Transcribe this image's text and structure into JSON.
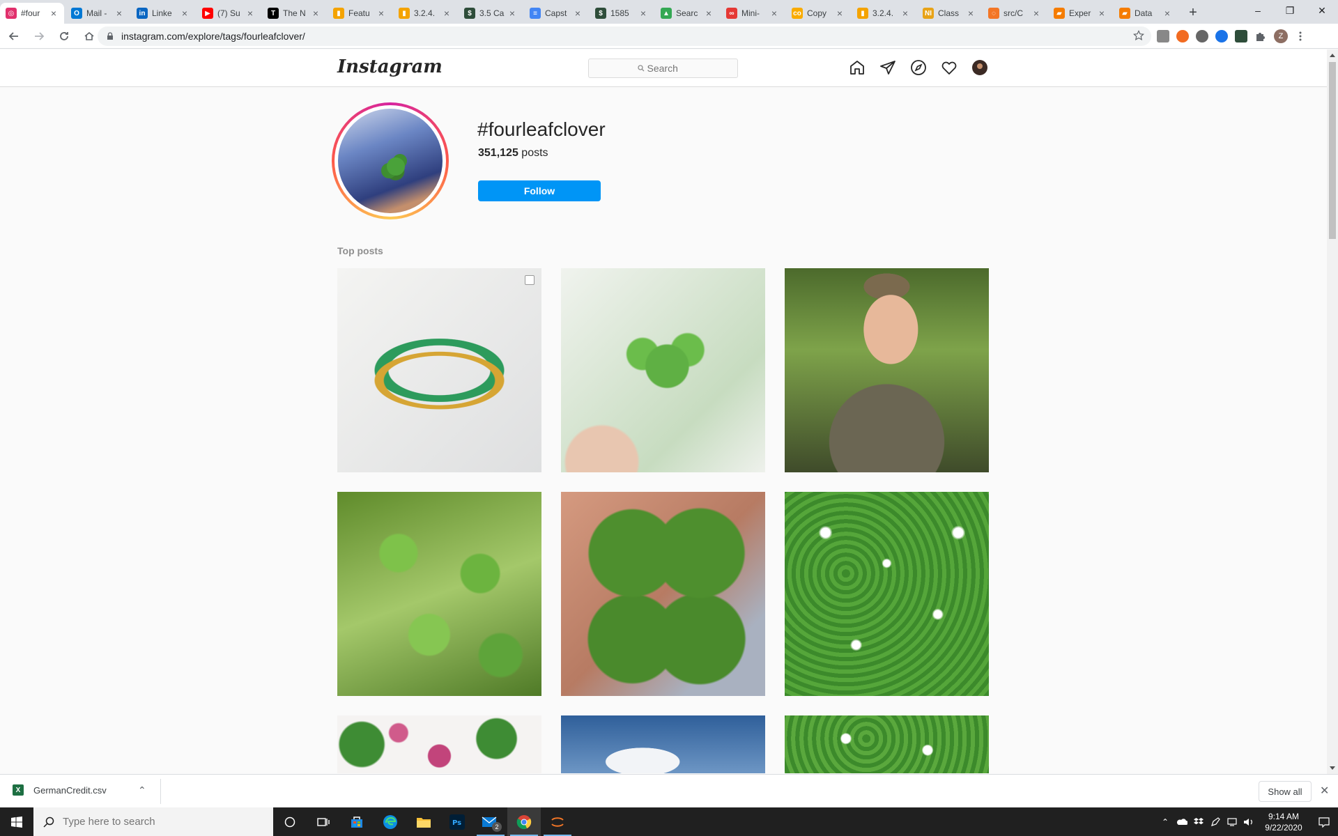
{
  "browser": {
    "tabs": [
      {
        "title": "#four",
        "favicon": "instagram-icon",
        "color": "#e1306c",
        "active": true
      },
      {
        "title": "Mail -",
        "favicon": "outlook-icon",
        "color": "#0078d4"
      },
      {
        "title": "Linke",
        "favicon": "linkedin-icon",
        "color": "#0a66c2"
      },
      {
        "title": "(7) Su",
        "favicon": "youtube-icon",
        "color": "#ff0000"
      },
      {
        "title": "The N",
        "favicon": "nytimes-icon",
        "color": "#000000"
      },
      {
        "title": "Featu",
        "favicon": "chart-icon",
        "color": "#f4a300"
      },
      {
        "title": "3.2.4.",
        "favicon": "chart-icon",
        "color": "#f4a300"
      },
      {
        "title": "3.5 Ca",
        "favicon": "dollar-icon",
        "color": "#2e4d3a"
      },
      {
        "title": "Capst",
        "favicon": "docs-icon",
        "color": "#4285f4"
      },
      {
        "title": "1585",
        "favicon": "dollar-icon",
        "color": "#2e4d3a"
      },
      {
        "title": "Searc",
        "favicon": "drive-icon",
        "color": "#34a853"
      },
      {
        "title": "Mini-",
        "favicon": "link-icon",
        "color": "#e53935"
      },
      {
        "title": "Copy",
        "favicon": "colab-icon",
        "color": "#f9ab00"
      },
      {
        "title": "3.2.4.",
        "favicon": "chart-icon",
        "color": "#f4a300"
      },
      {
        "title": "Class",
        "favicon": "ni-icon",
        "color": "#e8a317"
      },
      {
        "title": "src/C",
        "favicon": "jupyter-icon",
        "color": "#f37626"
      },
      {
        "title": "Exper",
        "favicon": "book-icon",
        "color": "#f57c00"
      },
      {
        "title": "Data",
        "favicon": "book-icon",
        "color": "#f57c00"
      }
    ],
    "url": "instagram.com/explore/tags/fourleafclover/",
    "profile_initial": "Z"
  },
  "instagram": {
    "logo": "Instagram",
    "search_placeholder": "Search",
    "hashtag": "#fourleafclover",
    "post_count": "351,125",
    "post_count_suffix": "posts",
    "follow_label": "Follow",
    "top_posts_label": "Top posts"
  },
  "downloads": {
    "file_name": "GermanCredit.csv",
    "show_all_label": "Show all"
  },
  "taskbar": {
    "search_placeholder": "Type here to search",
    "mail_badge": "2",
    "time": "9:14 AM",
    "date": "9/22/2020"
  }
}
